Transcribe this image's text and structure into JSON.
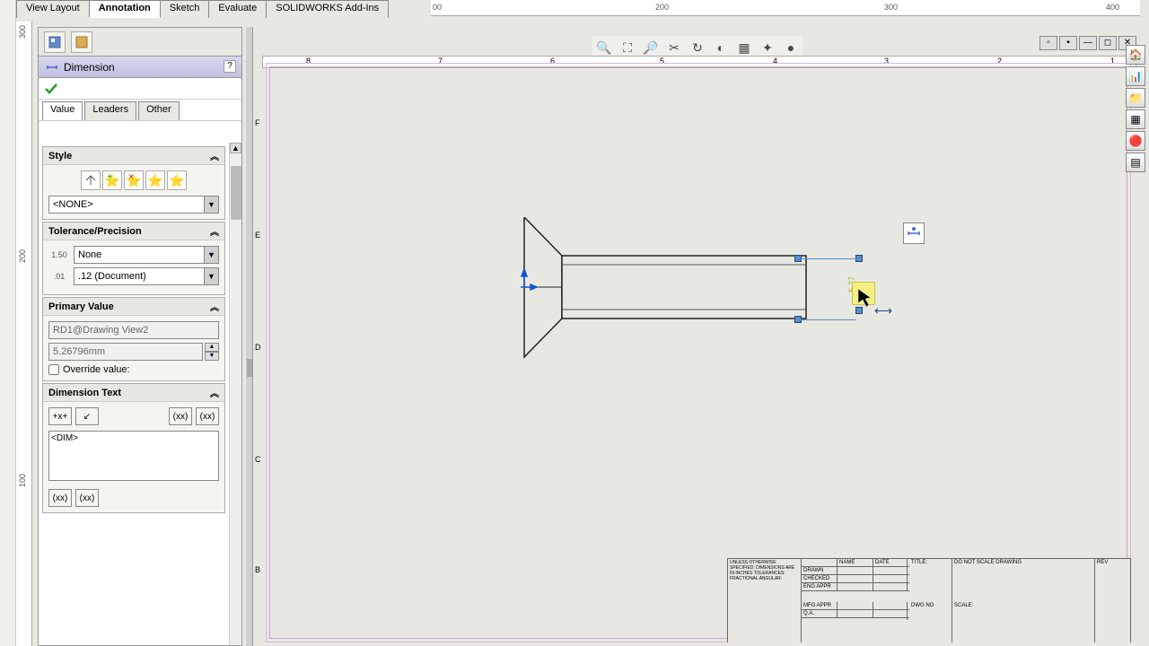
{
  "top_tabs": {
    "view_layout": "View Layout",
    "annotation": "Annotation",
    "sketch": "Sketch",
    "evaluate": "Evaluate",
    "addins": "SOLIDWORKS Add-Ins"
  },
  "ruler_top": [
    "00",
    "200",
    "300",
    "400"
  ],
  "panel": {
    "title": "Dimension",
    "help": "?",
    "sub_tabs": {
      "value": "Value",
      "leaders": "Leaders",
      "other": "Other"
    }
  },
  "style": {
    "head": "Style",
    "dropdown": "<NONE>"
  },
  "tolerance": {
    "head": "Tolerance/Precision",
    "icon1": "1.50",
    "dd1": "None",
    "icon2": ".01",
    "dd2": ".12 (Document)"
  },
  "primary": {
    "head": "Primary Value",
    "name": "RD1@Drawing View2",
    "value": "5.26796mm",
    "override_label": "Override value:"
  },
  "dimtext": {
    "head": "Dimension Text",
    "btn1": "+x+",
    "btn2": "↙",
    "btn3": "(xx)",
    "btn4": "(xx)",
    "text": "<DIM>",
    "btn5": "(xx)",
    "btn6": "(xx)"
  },
  "hruler": [
    "8",
    "7",
    "6",
    "5",
    "4",
    "3",
    "2",
    "1"
  ],
  "vruler": [
    "F",
    "E",
    "D",
    "C",
    "B"
  ],
  "dim_value": "5.27",
  "left_ruler": [
    "300",
    "200",
    "100"
  ],
  "title_block": {
    "r1c1": "UNLESS OTHERWISE SPECIFIED: DIMENSIONS ARE IN INCHES TOLERANCES: FRACTIONAL ANGULAR:",
    "r1c2": "NAME",
    "r1c3": "DATE",
    "drawn": "DRAWN",
    "checked": "CHECKED",
    "eng": "ENG APPR",
    "mfg": "MFG APPR",
    "qa": "Q.A.",
    "title_label": "TITLE:",
    "dwg": "DWG NO",
    "scale": "SCALE:",
    "rev": "REV",
    "do_not": "DO NOT SCALE DRAWING"
  }
}
